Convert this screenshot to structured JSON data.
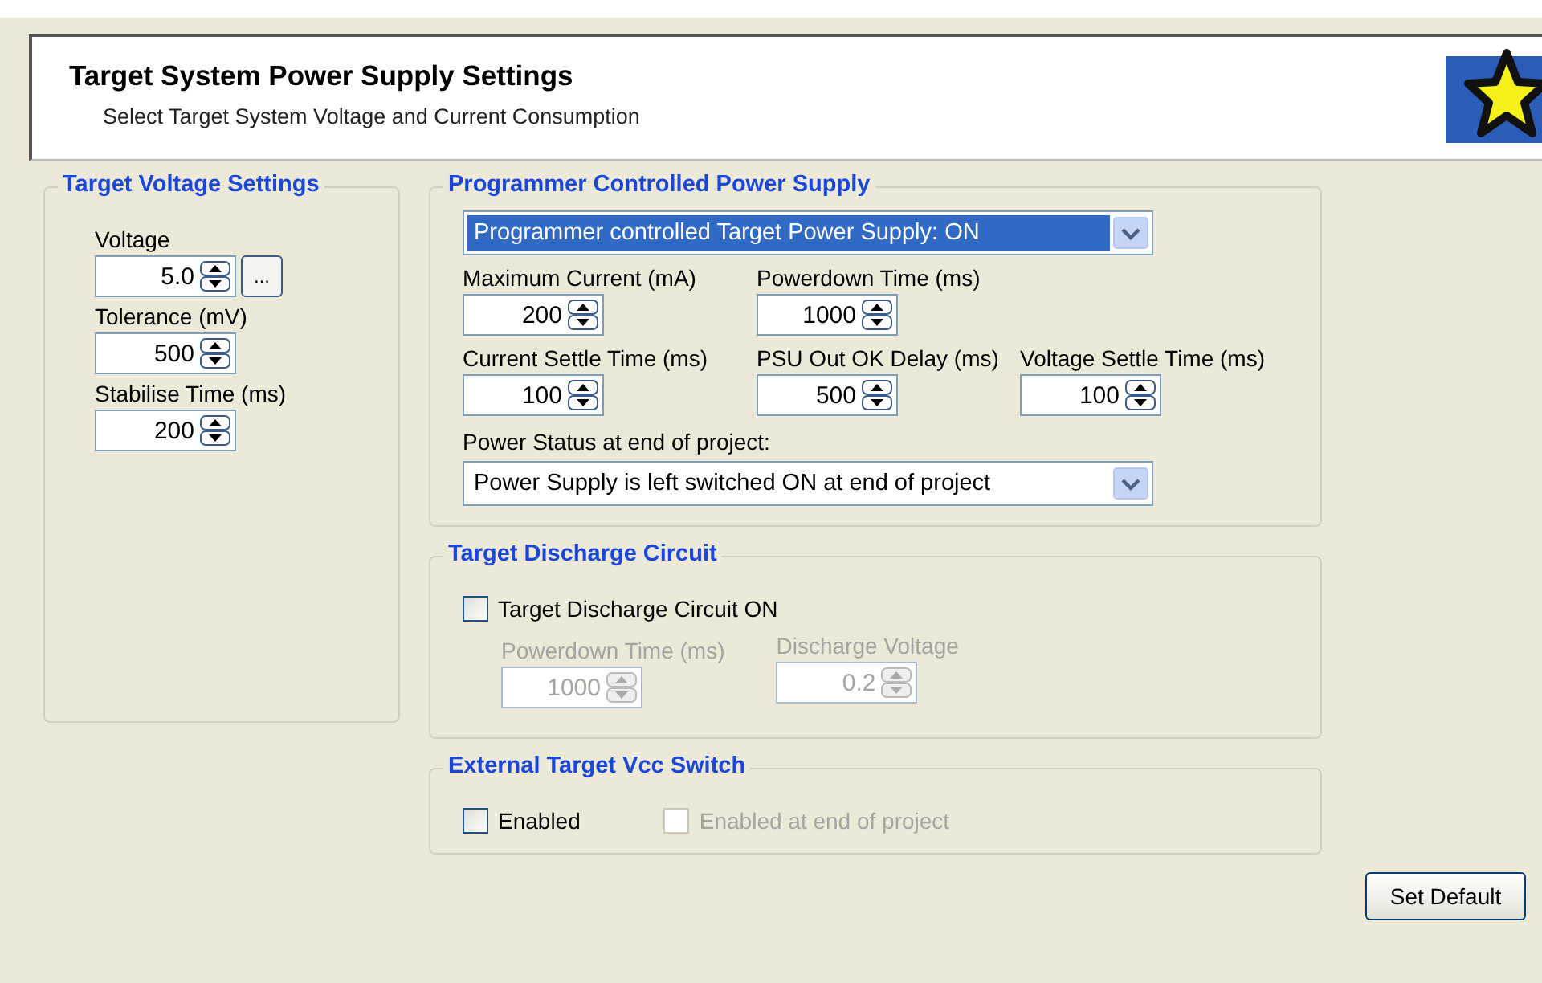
{
  "header": {
    "title": "Target System Power Supply Settings",
    "subtitle": "Select Target System Voltage and Current Consumption"
  },
  "voltage_group": {
    "title": "Target Voltage Settings",
    "fields": [
      {
        "label": "Voltage",
        "value": "5.0",
        "disabled": false,
        "browse_button": "..."
      },
      {
        "label": "Tolerance  (mV)",
        "value": "500",
        "disabled": false
      },
      {
        "label": "Stabilise Time (ms)",
        "value": "200",
        "disabled": false
      }
    ]
  },
  "power_group": {
    "title": "Programmer Controlled Power Supply",
    "mode_select": {
      "value": "Programmer controlled Target Power Supply: ON",
      "highlighted": true
    },
    "field_rows": [
      [
        {
          "label": "Maximum Current (mA)",
          "value": "200",
          "disabled": false
        },
        {
          "label": "Powerdown Time (ms)",
          "value": "1000",
          "disabled": false
        }
      ],
      [
        {
          "label": "Current Settle Time (ms)",
          "value": "100",
          "disabled": false
        },
        {
          "label": "PSU Out OK Delay (ms)",
          "value": "500",
          "disabled": false
        },
        {
          "label": "Voltage Settle Time (ms)",
          "value": "100",
          "disabled": false
        }
      ]
    ],
    "end_status_label": "Power Status at end of project:",
    "end_status_select": {
      "value": "Power Supply is left switched ON at end of project",
      "highlighted": false
    }
  },
  "discharge_group": {
    "title": "Target Discharge Circuit",
    "checkbox": {
      "label": "Target Discharge Circuit ON",
      "checked": false,
      "disabled": false
    },
    "fields": [
      {
        "label": "Powerdown Time (ms)",
        "value": "1000",
        "disabled": true
      },
      {
        "label": "Discharge Voltage",
        "value": "0.2",
        "disabled": true
      }
    ]
  },
  "vcc_group": {
    "title": "External Target Vcc Switch",
    "checkboxes": [
      {
        "label": "Enabled",
        "checked": false,
        "disabled": false
      },
      {
        "label": "Enabled at end of project",
        "checked": false,
        "disabled": true
      }
    ]
  },
  "set_default_button": "Set Default"
}
